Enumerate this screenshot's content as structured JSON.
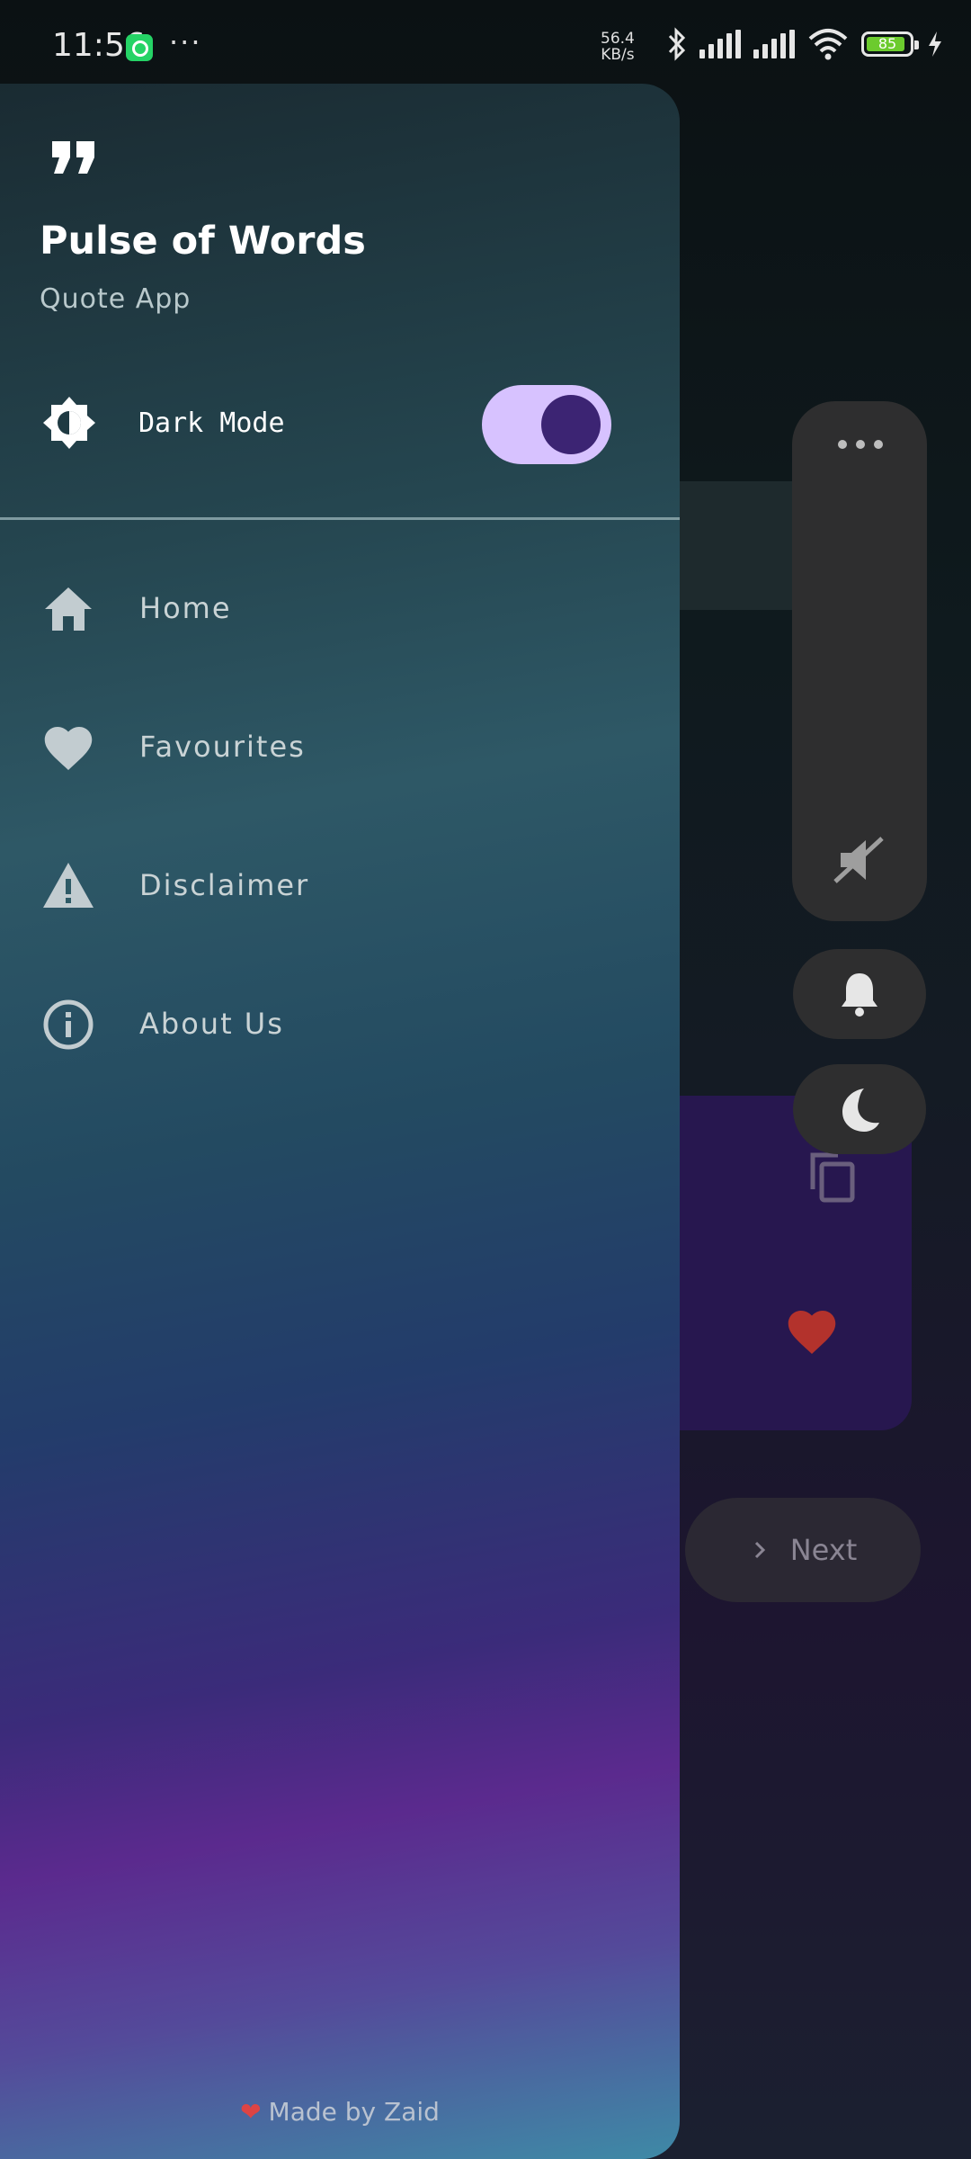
{
  "status_bar": {
    "time": "11:56",
    "net_speed_value": "56.4",
    "net_speed_unit": "KB/s",
    "battery_level": "85",
    "icons": [
      "whatsapp-icon",
      "more-dots-icon",
      "bluetooth-icon",
      "signal-icon",
      "signal-icon",
      "wifi-icon",
      "battery-icon",
      "charging-icon"
    ]
  },
  "drawer": {
    "app_title": "Pulse of Words",
    "app_subtitle": "Quote App",
    "dark_mode_label": "Dark Mode",
    "dark_mode_on": true,
    "items": [
      {
        "label": "Home",
        "icon": "home-icon"
      },
      {
        "label": "Favourites",
        "icon": "heart-icon"
      },
      {
        "label": "Disclaimer",
        "icon": "warning-icon"
      },
      {
        "label": "About Us",
        "icon": "info-icon"
      }
    ],
    "footer": "Made by Zaid"
  },
  "background": {
    "next_label": "Next"
  },
  "colors": {
    "toggle_track": "#d7c2ff",
    "toggle_knob": "#3c2473",
    "favourite_heart": "#b3322c",
    "overlay_panel": "#2e2e2f"
  }
}
